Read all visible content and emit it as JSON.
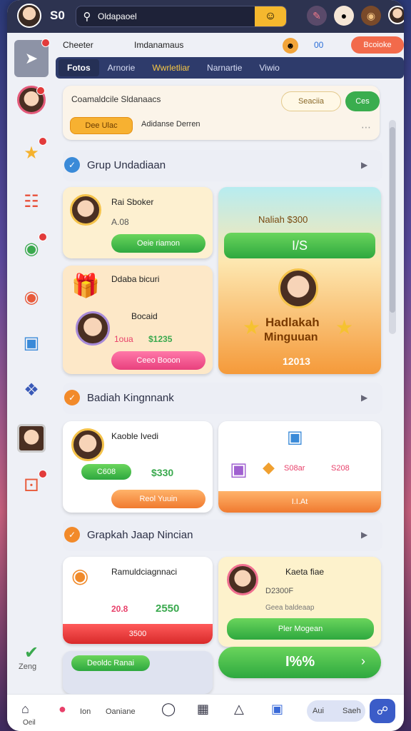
{
  "topbar": {
    "title": "S0",
    "search_value": "Oldapaoel"
  },
  "userrow": {
    "user1": "Cheeter",
    "user2": "Imdanamaus",
    "points": "00",
    "cta": "Bcoioke"
  },
  "tabs": [
    "Fotos",
    "Arnorie",
    "Wwrletliar",
    "Narnartie",
    "Viwio"
  ],
  "promo": {
    "title": "Coamaldcile Sldanaacs",
    "btn_outline": "Seaciia",
    "btn_go": "Ces",
    "chip": "Dee Ulac",
    "chip2": "Adidanse Derren"
  },
  "sections": {
    "s1": "Grup Undadiaan",
    "s2": "Badiah Kingnnank",
    "s3": "Grapkah Jaap Nincian"
  },
  "cards": {
    "c1": {
      "name": "Rai Sboker",
      "sub": "A.08",
      "button": "Oeie riamon"
    },
    "c2": {
      "name": "Ddaba bicuri",
      "name2": "Bocaid",
      "price1": "1oua",
      "price2": "$1235",
      "button": "Ceeo Booon"
    },
    "hero": {
      "ribbon": "Naliah $300",
      "banner": "I/S",
      "title1": "Hadlakah",
      "title2": "Minguuan",
      "value": "12013"
    },
    "c3": {
      "name": "Kaoble Ivedi",
      "chip": "C608",
      "price": "$330",
      "button": "Reol Yuuin"
    },
    "c4": {
      "price1": "S08ar",
      "price2": "S208",
      "button": "I.I.At"
    },
    "c5": {
      "name": "Ramuldciagnnaci",
      "value1": "20.8",
      "value2": "2550",
      "button": "3500"
    },
    "c6": {
      "name": "Kaeta fiae",
      "sub": "D2300F",
      "sub2": "Geea baldeaap",
      "button": "Pler Mogean"
    },
    "c7": {
      "chip": "Deoldc Ranai",
      "progress": "I%%"
    }
  },
  "rail": {
    "label": "Zeng"
  },
  "bottom_nav": {
    "home": "Oeil",
    "item": "Ion",
    "item2": "Oaniane",
    "profile": "Aui",
    "profile2": "Saeh"
  }
}
